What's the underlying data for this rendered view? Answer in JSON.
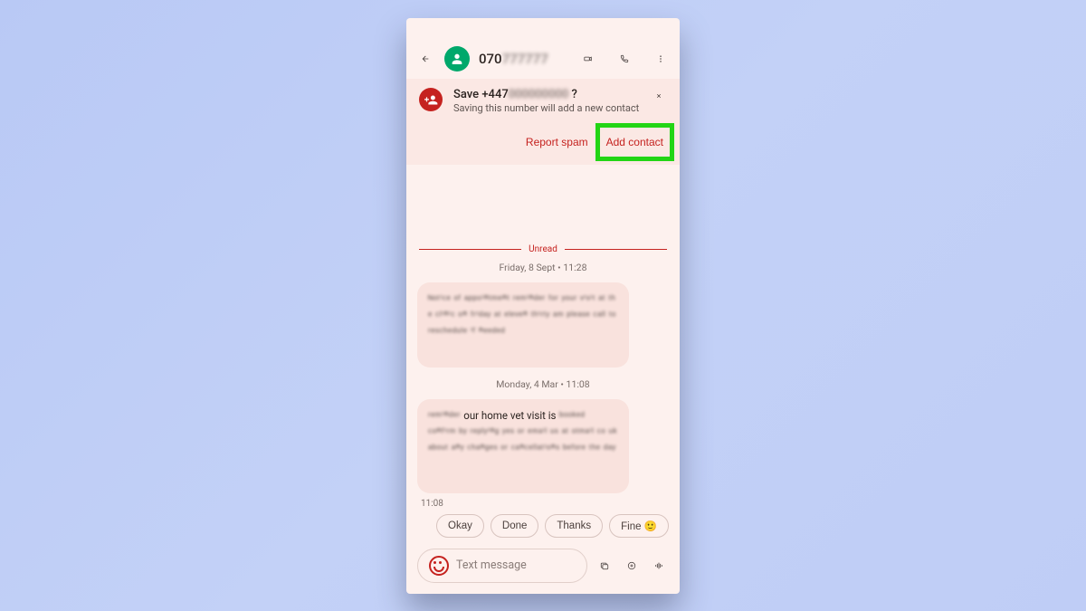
{
  "header": {
    "contact_prefix": "070",
    "contact_blur": "777777"
  },
  "save_card": {
    "title_prefix": "Save +447",
    "title_blur": "000000000",
    "title_suffix": " ?",
    "subtitle": "Saving this number will add a new contact",
    "report_spam": "Report spam",
    "add_contact": "Add contact"
  },
  "divider_label": "Unread",
  "thread": {
    "date1": "Friday, 8 Sept • 11:28",
    "date2": "Monday, 4 Mar • 11:08",
    "msg2_clear": "our home vet visit is",
    "time_small": "11:08"
  },
  "suggestions": [
    "Okay",
    "Done",
    "Thanks",
    "Fine 🙂"
  ],
  "composer": {
    "placeholder": "Text message"
  }
}
